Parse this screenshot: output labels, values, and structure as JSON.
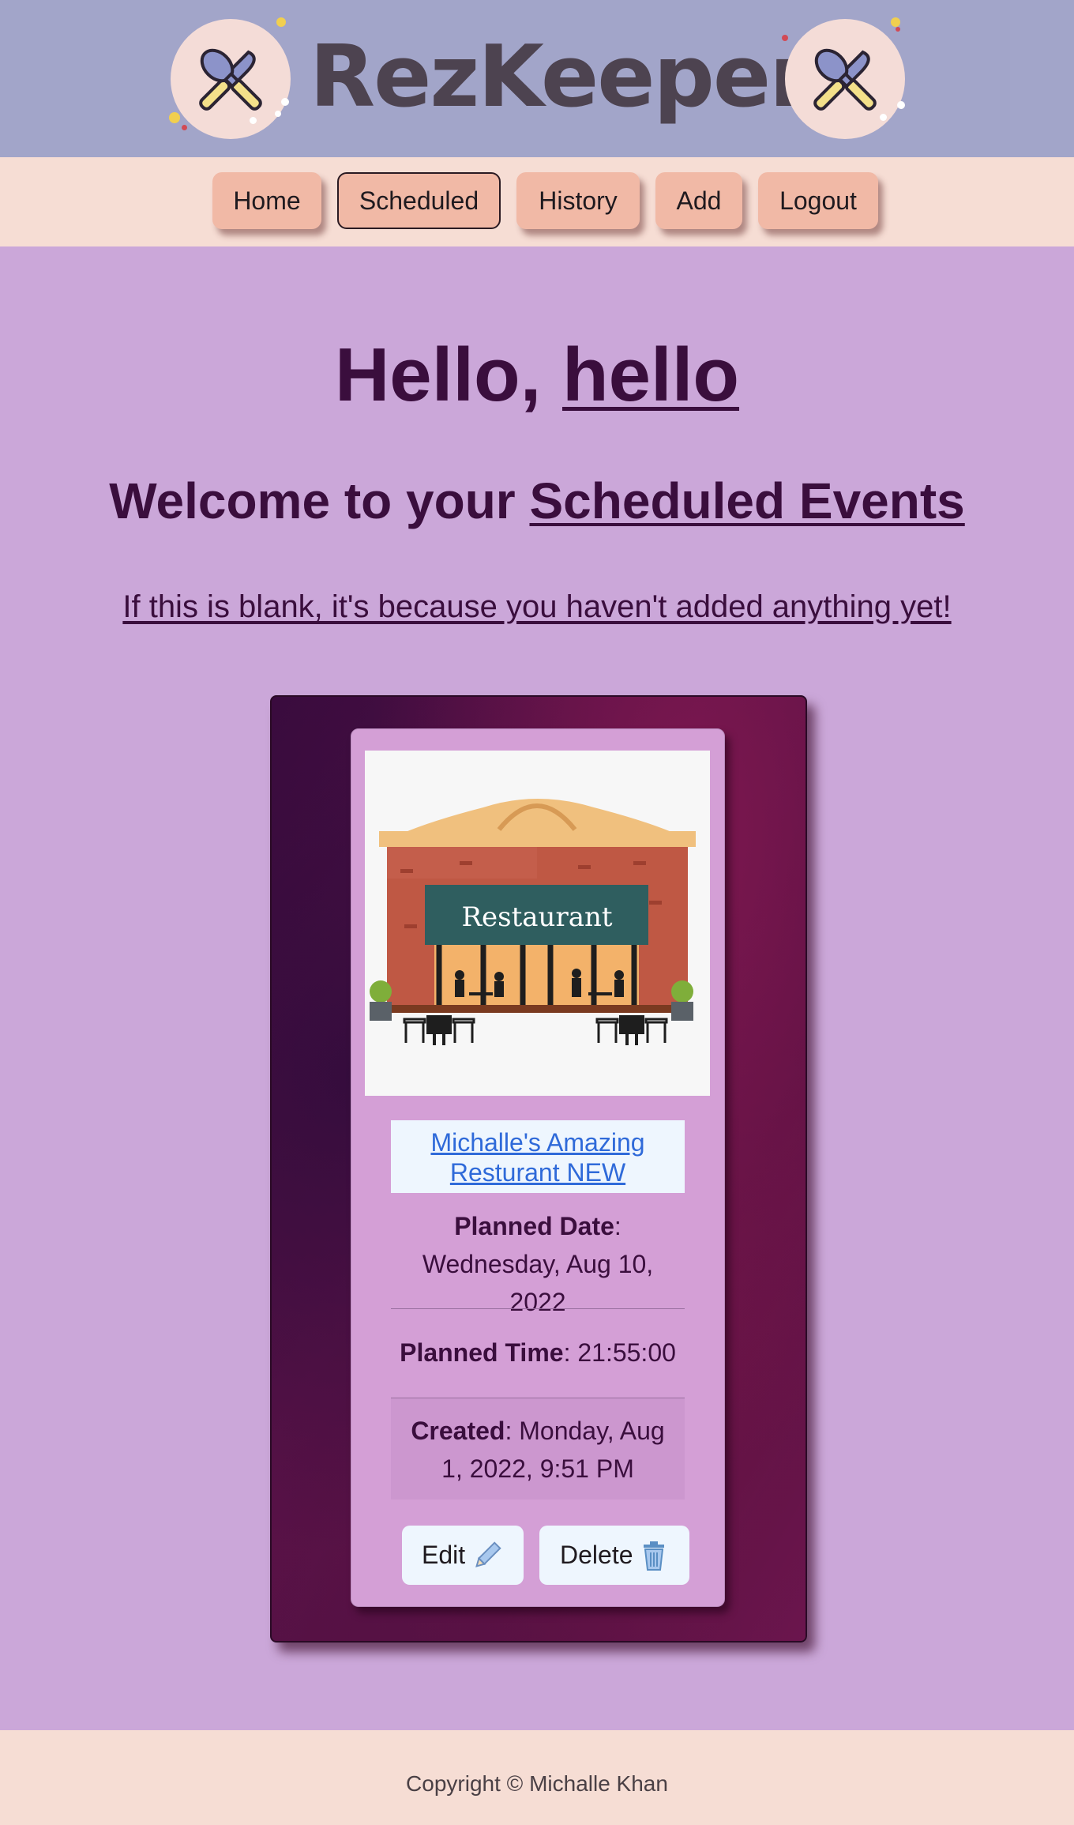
{
  "header": {
    "brand": "RezKeeper",
    "logo_icon": "crossed-knife-spoon-icon"
  },
  "nav": {
    "items": [
      {
        "label": "Home"
      },
      {
        "label": "Scheduled",
        "active": true
      },
      {
        "label": "History"
      },
      {
        "label": "Add"
      },
      {
        "label": "Logout"
      }
    ]
  },
  "main": {
    "greeting_prefix": "Hello, ",
    "username": "hello",
    "welcome_prefix": "Welcome to your ",
    "welcome_highlight": "Scheduled Events",
    "blank_note": "If this is blank, it's because you haven't added anything yet!"
  },
  "event": {
    "image_sign": "Restaurant",
    "restaurant_name": "Michalle's Amazing Resturant NEW",
    "planned_date_label": "Planned Date",
    "planned_date_value": "Wednesday, Aug 10, 2022",
    "planned_time_label": "Planned Time",
    "planned_time_value": "21:55:00",
    "created_label": "Created",
    "created_value": "Monday, Aug 1, 2022, 9:51 PM",
    "edit_label": "Edit",
    "edit_icon": "pencil-icon",
    "delete_label": "Delete",
    "delete_icon": "trash-icon"
  },
  "footer": {
    "copyright": "Copyright © Michalle Khan"
  },
  "colors": {
    "header_bg": "#a2a5c9",
    "nav_bg": "#f6ddd4",
    "nav_button": "#f1b9a6",
    "page_bg": "#cba7d9",
    "card_bg": "#d49fd6",
    "text_dark": "#3a0e3d",
    "link_blue": "#2f6ad9"
  }
}
